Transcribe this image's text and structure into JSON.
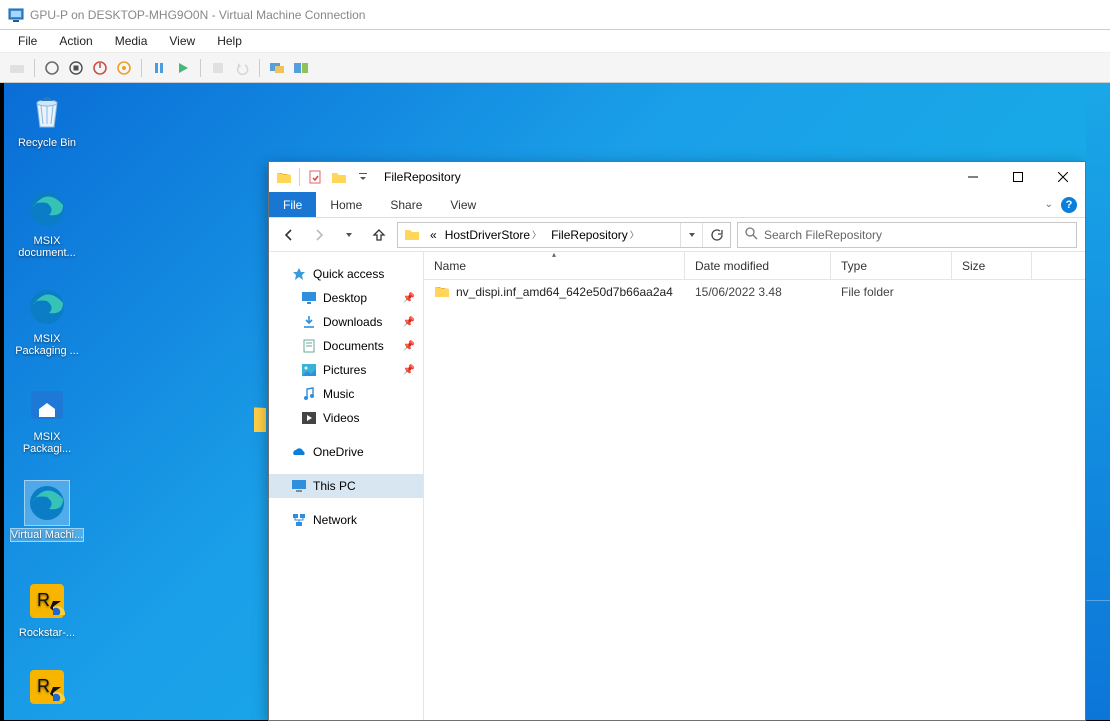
{
  "vmc": {
    "title": "GPU-P on DESKTOP-MHG9O0N - Virtual Machine Connection",
    "menu": {
      "file": "File",
      "action": "Action",
      "media": "Media",
      "view": "View",
      "help": "Help"
    }
  },
  "desktop_icons": {
    "recycle": "Recycle Bin",
    "msix_doc": "MSIX document...",
    "msix_pack": "MSIX Packaging ...",
    "msix_pack2": "MSIX Packagi...",
    "edge": "Virtual Machi...",
    "rockstar": "Rockstar-..."
  },
  "explorer": {
    "title": "FileRepository",
    "tabs": {
      "file": "File",
      "home": "Home",
      "share": "Share",
      "view": "View"
    },
    "breadcrumbs": {
      "ellipsis": "«",
      "seg1": "HostDriverStore",
      "seg2": "FileRepository"
    },
    "search_placeholder": "Search FileRepository",
    "nav": {
      "quick": "Quick access",
      "desktop": "Desktop",
      "downloads": "Downloads",
      "documents": "Documents",
      "pictures": "Pictures",
      "music": "Music",
      "videos": "Videos",
      "onedrive": "OneDrive",
      "thispc": "This PC",
      "network": "Network"
    },
    "columns": {
      "name": "Name",
      "date": "Date modified",
      "type": "Type",
      "size": "Size"
    },
    "rows": [
      {
        "name": "nv_dispi.inf_amd64_642e50d7b66aa2a4",
        "date": "15/06/2022 3.48",
        "type": "File folder",
        "size": ""
      }
    ]
  }
}
